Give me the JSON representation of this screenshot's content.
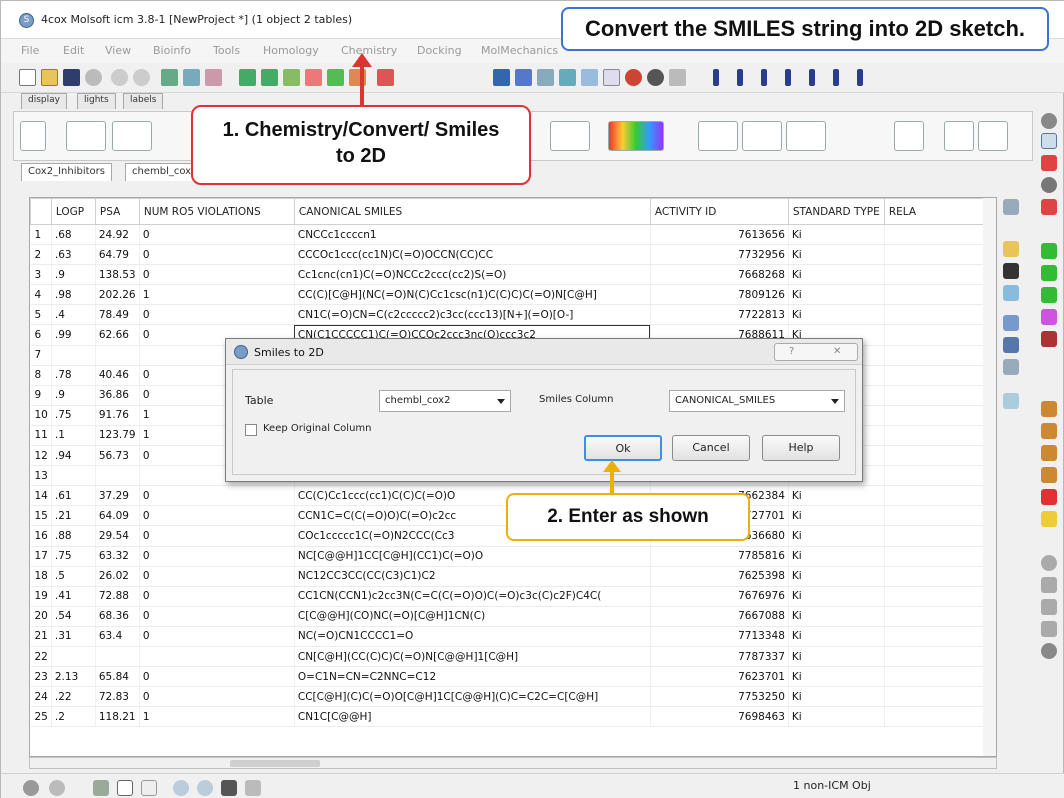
{
  "window": {
    "title": "4cox Molsoft icm 3.8-1  [NewProject *] (1 object 2 tables)"
  },
  "callout_top": "Convert the SMILES string into 2D sketch.",
  "menu": [
    "File",
    "Edit",
    "View",
    "Bioinfo",
    "Tools",
    "Homology",
    "Chemistry",
    "Docking",
    "MolMechanics"
  ],
  "inner_tabs": [
    "display",
    "lights",
    "labels"
  ],
  "callout1": {
    "line1": "1. Chemistry/Convert/ Smiles",
    "line2": "to 2D"
  },
  "table_tabs": [
    "Cox2_Inhibitors",
    "chembl_cox2"
  ],
  "table": {
    "columns": [
      "",
      "LOGP",
      "PSA",
      "NUM RO5 VIOLATIONS",
      "CANONICAL SMILES",
      "ACTIVITY ID",
      "STANDARD TYPE",
      "RELA"
    ],
    "rows": [
      [
        "1",
        ".68",
        "24.92",
        "0",
        "CNCCc1ccccn1",
        "7613656",
        "Ki"
      ],
      [
        "2",
        ".63",
        "64.79",
        "0",
        "CCCOc1ccc(cc1N)C(=O)OCCN(CC)CC",
        "7732956",
        "Ki"
      ],
      [
        "3",
        ".9",
        "138.53",
        "0",
        "Cc1cnc(cn1)C(=O)NCCc2ccc(cc2)S(=O)",
        "7668268",
        "Ki"
      ],
      [
        "4",
        ".98",
        "202.26",
        "1",
        "CC(C)[C@H](NC(=O)N(C)Cc1csc(n1)C(C)C)C(=O)N[C@H]",
        "7809126",
        "Ki"
      ],
      [
        "5",
        ".4",
        "78.49",
        "0",
        "CN1C(=O)CN=C(c2ccccc2)c3cc(ccc13)[N+](=O)[O-]",
        "7722813",
        "Ki"
      ],
      [
        "6",
        ".99",
        "62.66",
        "0",
        "CN(C1CCCCC1)C(=O)CCOc2ccc3nc(O)ccc3c2",
        "7688611",
        "Ki"
      ],
      [
        "7",
        "",
        "",
        "",
        "",
        "",
        ""
      ],
      [
        "8",
        ".78",
        "40.46",
        "0",
        "",
        "",
        ""
      ],
      [
        "9",
        ".9",
        "36.86",
        "0",
        "",
        "",
        ""
      ],
      [
        "10",
        ".75",
        "91.76",
        "1",
        "",
        "",
        ""
      ],
      [
        "11",
        ".1",
        "123.79",
        "1",
        "",
        "",
        ""
      ],
      [
        "12",
        ".94",
        "56.73",
        "0",
        "",
        "",
        ""
      ],
      [
        "13",
        "",
        "",
        "",
        "",
        "",
        ""
      ],
      [
        "14",
        ".61",
        "37.29",
        "0",
        "CC(C)Cc1ccc(cc1)C(C)C(=O)O",
        "7662384",
        "Ki"
      ],
      [
        "15",
        ".21",
        "64.09",
        "0",
        "CCN1C=C(C(=O)O)C(=O)c2cc",
        "7727701",
        "Ki"
      ],
      [
        "16",
        ".88",
        "29.54",
        "0",
        "COc1ccccc1C(=O)N2CCC(Cc3",
        "7636680",
        "Ki"
      ],
      [
        "17",
        ".75",
        "63.32",
        "0",
        "NC[C@@H]1CC[C@H](CC1)C(=O)O",
        "7785816",
        "Ki"
      ],
      [
        "18",
        ".5",
        "26.02",
        "0",
        "NC12CC3CC(CC(C3)C1)C2",
        "7625398",
        "Ki"
      ],
      [
        "19",
        ".41",
        "72.88",
        "0",
        "CC1CN(CCN1)c2cc3N(C=C(C(=O)O)C(=O)c3c(C)c2F)C4C(",
        "7676976",
        "Ki"
      ],
      [
        "20",
        ".54",
        "68.36",
        "0",
        "C[C@@H](CO)NC(=O)[C@H]1CN(C)",
        "7667088",
        "Ki"
      ],
      [
        "21",
        ".31",
        "63.4",
        "0",
        "NC(=O)CN1CCCC1=O",
        "7713348",
        "Ki"
      ],
      [
        "22",
        "",
        "",
        "",
        "CN[C@H](CC(C)C)C(=O)N[C@@H]1[C@H]",
        "7787337",
        "Ki"
      ],
      [
        "23",
        "2.13",
        "65.84",
        "0",
        "O=C1N=CN=C2NNC=C12",
        "7623701",
        "Ki"
      ],
      [
        "24",
        ".22",
        "72.83",
        "0",
        "CC[C@H](C)C(=O)O[C@H]1C[C@@H](C)C=C2C=C[C@H]",
        "7753250",
        "Ki"
      ],
      [
        "25",
        ".2",
        "118.21",
        "1",
        "CN1C[C@@H]",
        "7698463",
        "Ki"
      ]
    ]
  },
  "dialog": {
    "title": "Smiles to 2D",
    "table_label": "Table",
    "table_value": "chembl_cox2",
    "smiles_label": "Smiles Column",
    "smiles_value": "CANONICAL_SMILES",
    "keep_label": "Keep Original Column",
    "ok": "Ok",
    "cancel": "Cancel",
    "help": "Help"
  },
  "callout2": "2. Enter as shown",
  "status": {
    "text": "1 non-ICM Obj"
  },
  "colors": {
    "callout_blue": "#3c72d0",
    "callout_red": "#d33333",
    "callout_yellow": "#e9b10c",
    "ok_focus": "#3c8ee6"
  },
  "icons": [
    "app-icon",
    "new-icon",
    "open-icon",
    "save-icon",
    "undo-icon",
    "redo-icon",
    "search-icon",
    "zoom-icon",
    "help-icon"
  ]
}
